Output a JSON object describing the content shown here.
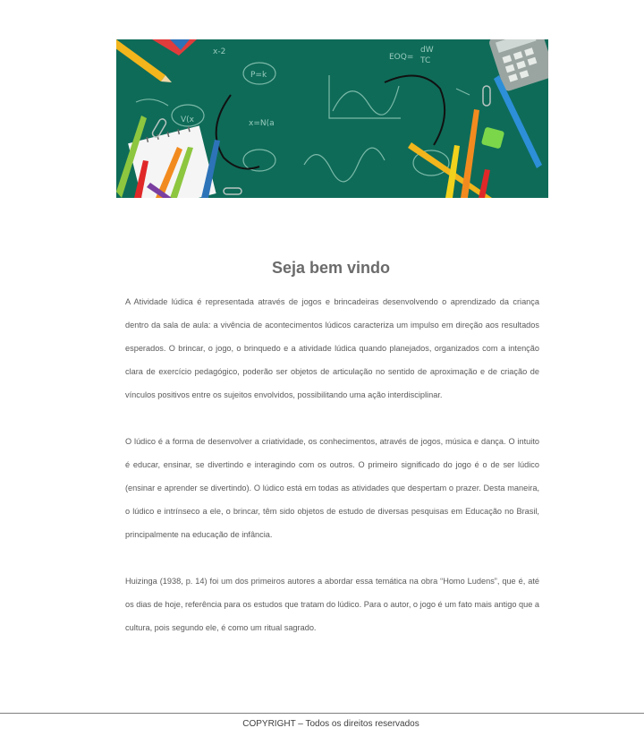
{
  "banner": {
    "background_color": "#0e6b58",
    "chalk_formulas": [
      "EOQ=",
      "x-2",
      "P=k",
      "dW",
      "TC",
      "x=N(a",
      "V(x"
    ]
  },
  "page_title": "Seja bem vindo",
  "paragraphs": [
    "A Atividade lúdica é representada através de jogos e brincadeiras desenvolvendo o aprendizado da criança dentro da sala de aula: a vivência de acontecimentos lúdicos caracteriza um impulso em direção aos resultados esperados. O brincar, o jogo, o brinquedo e a atividade lúdica quando planejados, organizados com a intenção clara de exercício pedagógico, poderão ser objetos de articulação no sentido de aproximação e de criação de vínculos positivos entre os sujeitos envolvidos, possibilitando uma ação interdisciplinar.",
    "O lúdico é a forma de desenvolver a criatividade, os conhecimentos, através de jogos, música e dança. O intuito é educar, ensinar, se divertindo e interagindo com os outros. O primeiro significado do jogo é o de ser lúdico (ensinar e aprender se divertindo). O lúdico está em todas as atividades que despertam o prazer. Desta maneira, o lúdico e intrínseco a ele, o brincar, têm sido objetos de estudo de diversas pesquisas em Educação no Brasil, principalmente na educação de infância.",
    "Huizinga (1938, p. 14) foi um dos primeiros autores a abordar essa temática na obra “Homo Ludens”, que é, até os dias de hoje, referência para os estudos que tratam do lúdico. Para o autor, o jogo é um fato mais antigo que a cultura, pois segundo ele, é como um ritual sagrado."
  ],
  "footer": {
    "copyright": "COPYRIGHT – Todos os direitos reservados"
  }
}
